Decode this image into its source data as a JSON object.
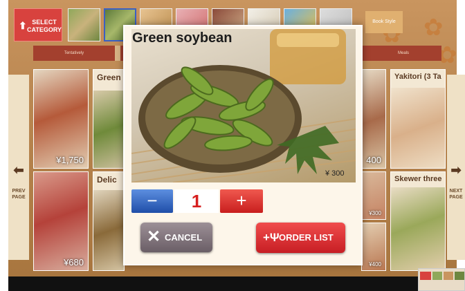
{
  "header": {
    "select_category_label": "SELECT CATEGORY",
    "book_style_label": "Book Style",
    "tabs": [
      "Tentatively",
      "Meals"
    ]
  },
  "nav": {
    "prev_label": "PREV PAGE",
    "next_label": "NEXT PAGE"
  },
  "menu_cards": [
    {
      "title": "",
      "price": "¥1,750"
    },
    {
      "title": "Green",
      "price": ""
    },
    {
      "title": "",
      "price": "¥680"
    },
    {
      "title": "Delic",
      "price": ""
    },
    {
      "title": "",
      "price": "400"
    },
    {
      "title": "",
      "price": "¥300"
    },
    {
      "title": "",
      "price": "¥400"
    },
    {
      "title": "Yakitori (3 Ta",
      "price": ""
    },
    {
      "title": "Skewer three",
      "price": ""
    }
  ],
  "dialog": {
    "item_name": "Green soybean",
    "price": "¥ 300",
    "quantity": "1",
    "minus_label": "−",
    "plus_label": "+",
    "cancel_label": "CANCEL",
    "order_list_label": "ORDER LIST"
  },
  "colors": {
    "accent_red": "#d8423e",
    "minus_blue": "#1f4ea8",
    "background_brown": "#b98650"
  },
  "icons": [
    "up-arrow-icon",
    "left-arrow-icon",
    "right-arrow-icon",
    "close-x-icon",
    "fork-knife-plus-icon"
  ]
}
